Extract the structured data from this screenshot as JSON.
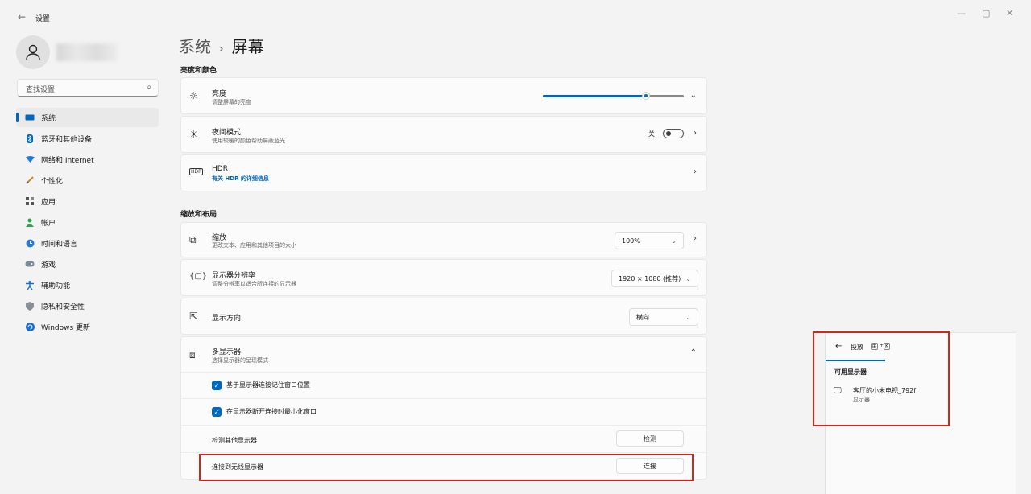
{
  "window": {
    "title": "设置",
    "controls": [
      "—",
      "▢",
      "✕"
    ]
  },
  "search": {
    "placeholder": "查找设置"
  },
  "sidebar": {
    "items": [
      {
        "label": "系统",
        "icon": "monitor-icon",
        "active": true
      },
      {
        "label": "蓝牙和其他设备",
        "icon": "bluetooth-icon"
      },
      {
        "label": "网络和 Internet",
        "icon": "wifi-icon"
      },
      {
        "label": "个性化",
        "icon": "brush-icon"
      },
      {
        "label": "应用",
        "icon": "apps-icon"
      },
      {
        "label": "帐户",
        "icon": "account-icon"
      },
      {
        "label": "时间和语言",
        "icon": "globe-clock-icon"
      },
      {
        "label": "游戏",
        "icon": "gamepad-icon"
      },
      {
        "label": "辅助功能",
        "icon": "accessibility-icon"
      },
      {
        "label": "隐私和安全性",
        "icon": "shield-icon"
      },
      {
        "label": "Windows 更新",
        "icon": "update-icon"
      }
    ]
  },
  "breadcrumb": {
    "parent": "系统",
    "separator": "›",
    "current": "屏幕"
  },
  "sections": {
    "brightness_color": "亮度和颜色",
    "scale_layout": "缩放和布局"
  },
  "brightness": {
    "title": "亮度",
    "subtitle": "调整屏幕的亮度",
    "level": 0.73
  },
  "night_light": {
    "title": "夜间模式",
    "subtitle": "使用较暖的颜色帮助屏蔽蓝光",
    "state_label": "关",
    "on": false
  },
  "hdr": {
    "title": "HDR",
    "link": "有关 HDR 的详细信息"
  },
  "scale": {
    "title": "缩放",
    "subtitle": "更改文本、应用和其他项目的大小",
    "value": "100%"
  },
  "resolution": {
    "title": "显示器分辨率",
    "subtitle": "调整分辨率以适合所连接的显示器",
    "value": "1920 × 1080 (推荐)"
  },
  "orientation": {
    "title": "显示方向",
    "value": "横向"
  },
  "multi_display": {
    "title": "多显示器",
    "subtitle": "选择显示器的呈现模式",
    "remember_windows": "基于显示器连接记住窗口位置",
    "minimize_windows": "在显示器断开连接时最小化窗口",
    "detect_label": "检测其他显示器",
    "detect_button": "检测",
    "wireless_label": "连接到无线显示器",
    "wireless_button": "连接"
  },
  "cast_panel": {
    "title": "投放",
    "shortcut_key1": "⊞",
    "shortcut_plus": "+",
    "shortcut_key2": "K",
    "available_label": "可用显示器",
    "device_name": "客厅的小米电视_792f",
    "device_type": "显示器"
  },
  "colors": {
    "accent": "#0067c0",
    "highlight": "#d4241c"
  }
}
